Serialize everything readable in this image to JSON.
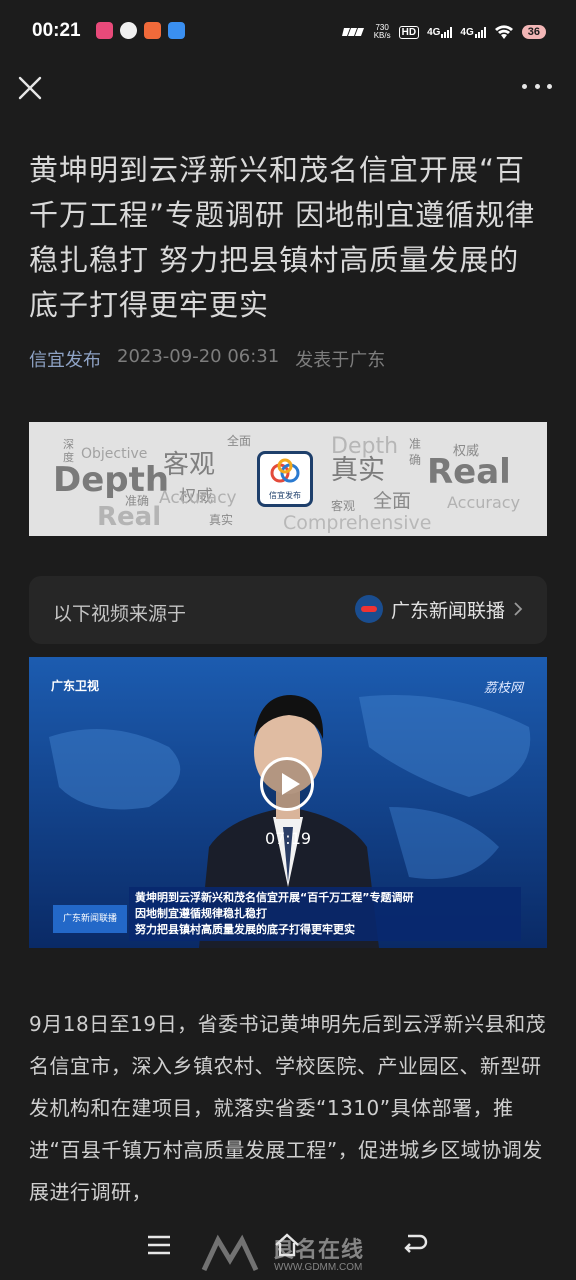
{
  "status_bar": {
    "time": "00:21",
    "speed_value": "730",
    "speed_unit": "KB/s",
    "hd_label": "HD",
    "network_1": "4G",
    "network_2": "4G",
    "battery": "36"
  },
  "toolbar": {
    "close_icon": "close-icon",
    "more_icon": "more-icon"
  },
  "article": {
    "title": "黄坤明到云浮新兴和茂名信宜开展“百千万工程”专题调研 因地制宜遵循规律稳扎稳打 努力把县镇村高质量发展的底子打得更牢更实",
    "source": "信宜发布",
    "datetime": "2023-09-20 06:31",
    "location": "发表于广东",
    "body": "9月18日至19日，省委书记黄坤明先后到云浮新兴县和茂名信宜市，深入乡镇农村、学校医院、产业园区、新型研发机构和在建项目，就落实省委“1310”具体部署，推进“百县千镇万村高质量发展工程”，促进城乡区域协调发展进行调研，"
  },
  "banner": {
    "logo_text": "信宜发布",
    "words": {
      "shendu": "深度",
      "objective": "Objective",
      "depth": "Depth",
      "zhunque": "准确",
      "real": "Real",
      "keguan": "客观",
      "quanwei": "权威",
      "quanmian": "全面",
      "accuracy": "Accuracy",
      "zhenshi": "真实",
      "comprehensive": "Comprehensive"
    }
  },
  "video_source": {
    "label": "以下视频来源于",
    "channel": "广东新闻联播",
    "chevron_icon": "chevron-right-icon"
  },
  "video": {
    "duration": "07:19",
    "channel_watermark": "广东卫视",
    "site_watermark": "荔枝网",
    "ticker_tag": "广东新闻联播",
    "caption_lines": [
      "黄坤明到云浮新兴和茂名信宜开展“百千万工程”专题调研",
      "因地制宜遵循规律稳扎稳打",
      "努力把县镇村高质量发展的底子打得更牢更实"
    ]
  },
  "nav": {
    "menu_icon": "menu-icon",
    "home_icon": "home-icon",
    "back_icon": "back-icon",
    "watermark_text": "良名在线",
    "watermark_url": "WWW.GDMM.COM"
  },
  "colors": {
    "background": "#1c1c1c",
    "source_link": "#8ea2c4",
    "video_blue": "#0d3a78"
  }
}
